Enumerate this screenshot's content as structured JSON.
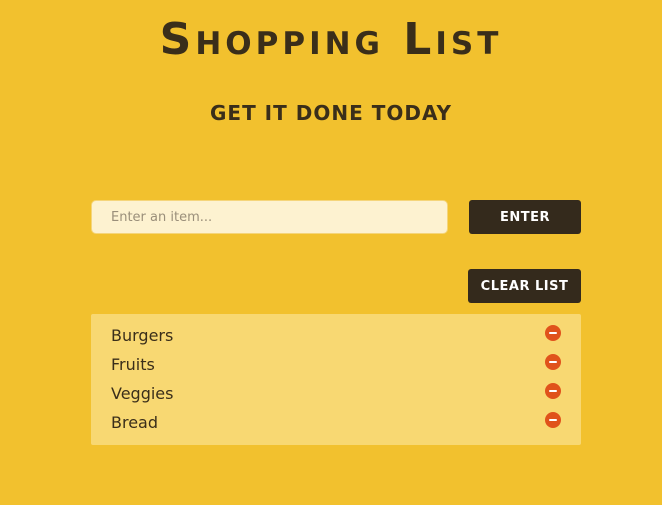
{
  "header": {
    "title": "Shopping List",
    "subtitle": "GET IT DONE TODAY"
  },
  "entry": {
    "placeholder": "Enter an item...",
    "value": "",
    "enter_label": "ENTER"
  },
  "list": {
    "clear_label": "CLEAR LIST",
    "items": [
      {
        "label": "Burgers",
        "remove_icon": "remove-circle-icon"
      },
      {
        "label": "Fruits",
        "remove_icon": "remove-circle-icon"
      },
      {
        "label": "Veggies",
        "remove_icon": "remove-circle-icon"
      },
      {
        "label": "Bread",
        "remove_icon": "remove-circle-icon"
      }
    ]
  },
  "colors": {
    "background": "#f2c12e",
    "text": "#3a2e1a",
    "button": "#342a1c",
    "input_bg": "#fdf2d0",
    "list_bg": "#f8d872",
    "remove_icon": "#e0521b"
  }
}
